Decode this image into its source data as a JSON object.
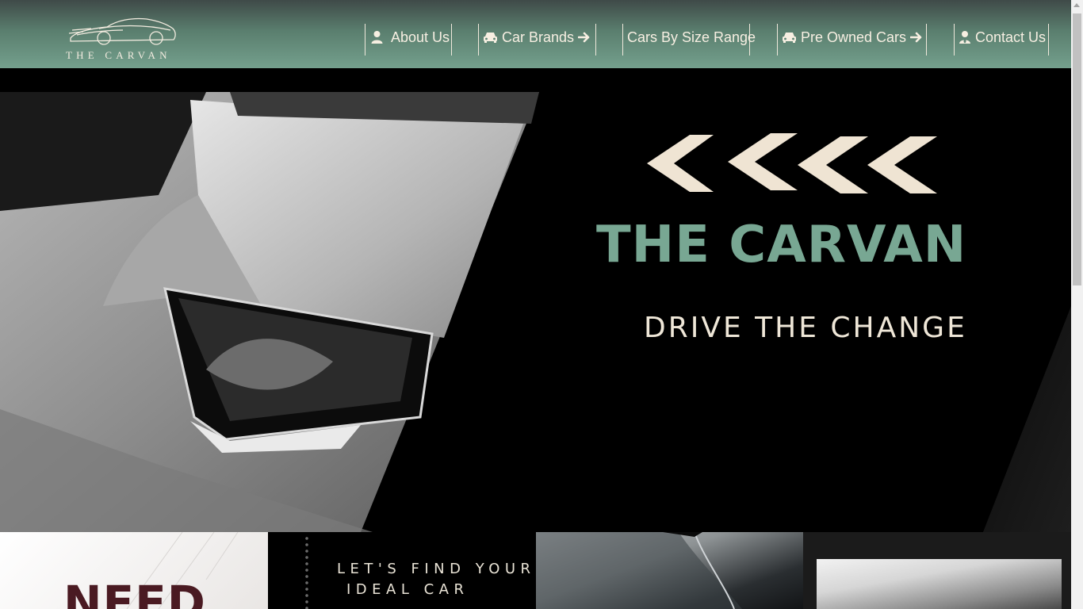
{
  "header": {
    "logo_text": "THE CARVAN",
    "nav": [
      {
        "label": "About Us",
        "icon": "user-icon",
        "arrow": false
      },
      {
        "label": "Car Brands",
        "icon": "car-icon",
        "arrow": true
      },
      {
        "label": "Cars By Size Range",
        "icon": "",
        "arrow": false
      },
      {
        "label": "Pre Owned Cars",
        "icon": "car-icon",
        "arrow": true
      },
      {
        "label": "Contact Us",
        "icon": "user-tie-icon",
        "arrow": false
      }
    ]
  },
  "hero": {
    "title": "THE CARVAN",
    "tagline": "DRIVE THE CHANGE"
  },
  "strip": {
    "tile1_text": "NEED",
    "tagline_line1": "LET'S FIND YOUR",
    "tagline_line2": "IDEAL CAR"
  },
  "colors": {
    "header_top": "#3f4a48",
    "header_bottom": "#74a08d",
    "nav_text": "#f7efe2",
    "accent_green": "#78a793",
    "cream": "#efe7d8",
    "maroon": "#4a1a22"
  }
}
